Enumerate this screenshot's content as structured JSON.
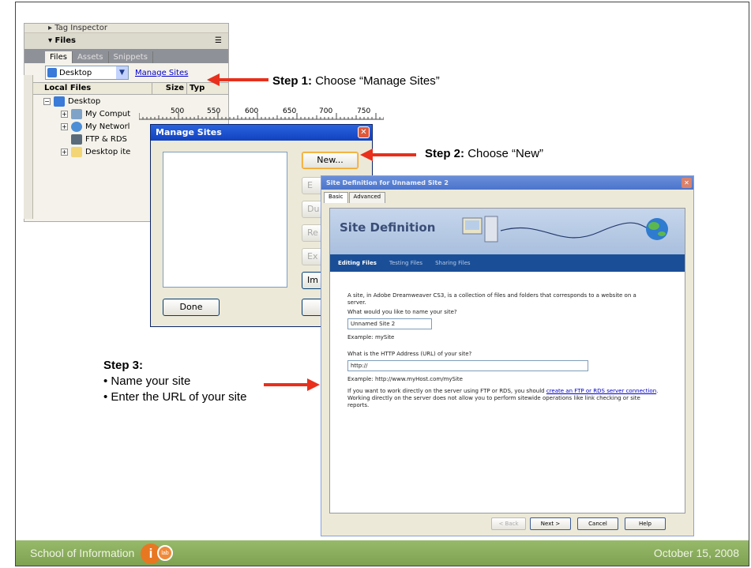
{
  "files_panel": {
    "tag_inspector": "Tag Inspector",
    "title": "Files",
    "tabs": [
      "Files",
      "Assets",
      "Snippets"
    ],
    "site_select": "Desktop",
    "manage_sites_link": "Manage Sites",
    "columns": [
      "Local Files",
      "Size",
      "Typ"
    ],
    "tree": [
      {
        "label": "Desktop",
        "icon": "desktop-icon"
      },
      {
        "label": "My Comput",
        "icon": "computer-icon"
      },
      {
        "label": "My Networl",
        "icon": "network-icon"
      },
      {
        "label": "FTP & RDS",
        "icon": "server-icon"
      },
      {
        "label": "Desktop ite",
        "icon": "folder-icon"
      }
    ]
  },
  "ruler": {
    "ticks": [
      "500",
      "550",
      "600",
      "650",
      "700",
      "750"
    ]
  },
  "manage_sites": {
    "title": "Manage Sites",
    "buttons": [
      "New...",
      "E",
      "Du",
      "Re",
      "Ex",
      "Im"
    ],
    "done": "Done"
  },
  "site_definition": {
    "title": "Site Definition for Unnamed Site 2",
    "tabs": [
      "Basic",
      "Advanced"
    ],
    "banner_title": "Site Definition",
    "nav": [
      "Editing Files",
      "Testing Files",
      "Sharing Files"
    ],
    "intro": "A site, in Adobe Dreamweaver CS3, is a collection of files and folders that corresponds to a website on a server.",
    "q_name": "What would you like to name your site?",
    "name_value": "Unnamed Site 2",
    "name_example": "Example: mySite",
    "q_url": "What is the HTTP Address (URL) of your site?",
    "url_value": "http://",
    "url_example": "Example: http://www.myHost.com/mySite",
    "ftp_text_1": "If you want to work directly on the server using FTP or RDS, you should",
    "ftp_link": "create an FTP or RDS server connection",
    "ftp_text_2": ". Working directly on the server does not allow you to perform sitewide operations like link checking or site reports.",
    "buttons": [
      "< Back",
      "Next >",
      "Cancel",
      "Help"
    ]
  },
  "steps": {
    "step1_label": "Step 1:",
    "step1_text": "Choose “Manage Sites”",
    "step2_label": "Step 2:",
    "step2_text": "Choose “New”",
    "step3_label": "Step 3:",
    "step3_bullets": [
      "Name your site",
      "Enter the URL of your site"
    ]
  },
  "footer": {
    "school": "School of Information",
    "logo_i": "i",
    "logo_lab": "lab",
    "date": "October 15, 2008"
  },
  "colors": {
    "arrow": "#e8301c",
    "footer": "#8aaf5e",
    "xp_title": "#1f55d6"
  }
}
